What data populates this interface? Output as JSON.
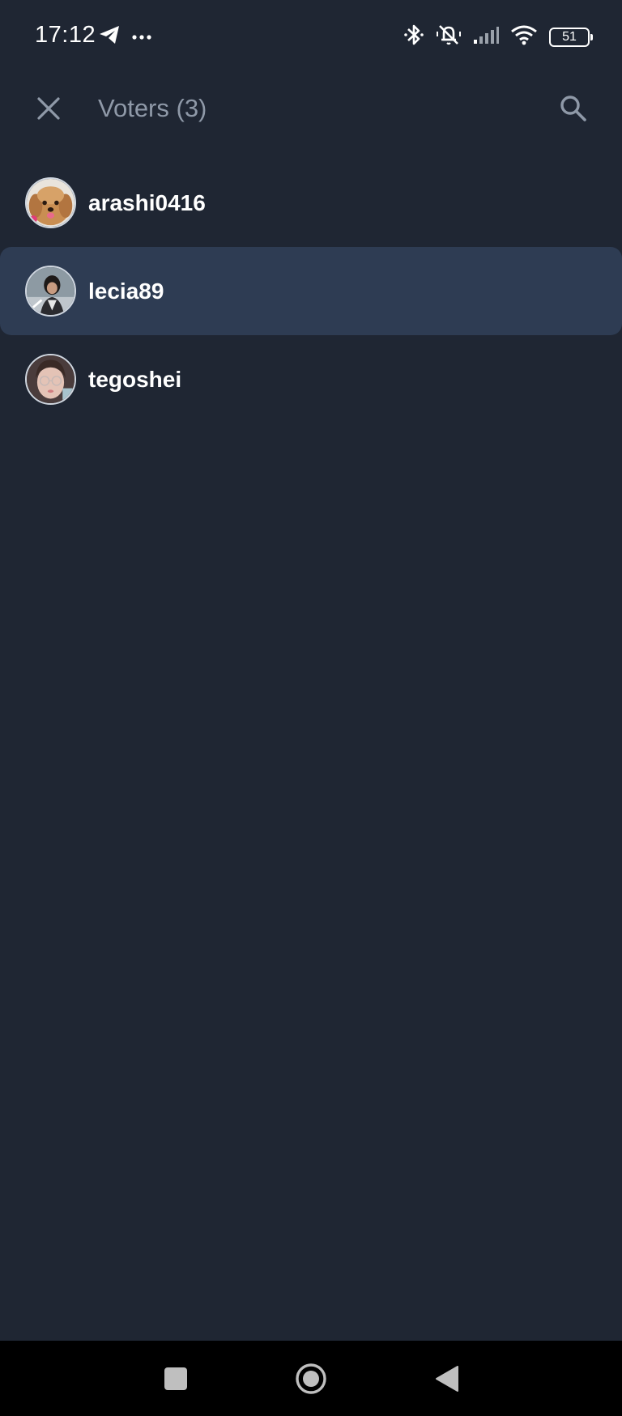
{
  "status_bar": {
    "time": "17:12",
    "left_icons": [
      "telegram-icon",
      "more-dots-icon"
    ],
    "right_icons": [
      "bluetooth-icon",
      "silent-mode-icon",
      "signal-icon",
      "wifi-icon",
      "battery-icon"
    ],
    "battery_level": "51"
  },
  "header": {
    "title": "Voters (3)",
    "close_icon": "close-icon",
    "search_icon": "search-icon"
  },
  "voters": [
    {
      "name": "arashi0416",
      "avatar": "dog-avatar",
      "highlighted": false
    },
    {
      "name": "lecia89",
      "avatar": "person-avatar",
      "highlighted": true
    },
    {
      "name": "tegoshei",
      "avatar": "person-glasses-avatar",
      "highlighted": false
    }
  ],
  "nav_bar": {
    "buttons": [
      "recent-apps-icon",
      "home-icon",
      "back-icon"
    ]
  },
  "colors": {
    "background": "#1f2633",
    "highlight_row": "#2e3c53",
    "header_title": "#8f99a8",
    "icon_gray": "#8f99a8",
    "nav_background": "#000000"
  }
}
